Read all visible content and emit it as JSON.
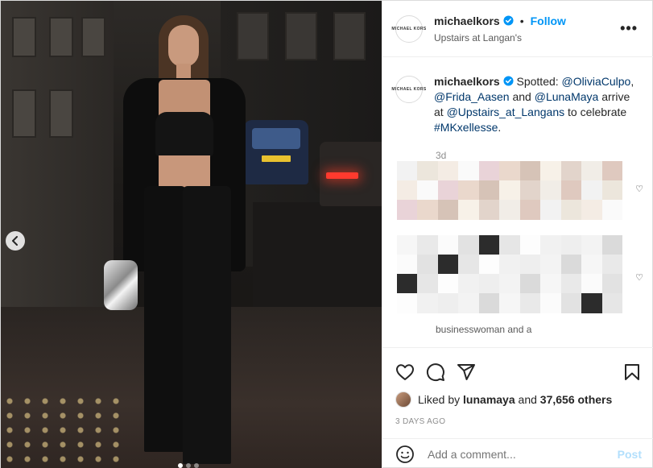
{
  "header": {
    "avatar_text": "MICHAEL KORS",
    "username": "michaelkors",
    "separator": "•",
    "follow_label": "Follow",
    "location": "Upstairs at Langan's",
    "more_label": "•••"
  },
  "caption": {
    "username": "michaelkors",
    "text_1": "Spotted: ",
    "mention_1": "@OliviaCulpo",
    "text_2": ", ",
    "mention_2": "@Frida_Aasen",
    "text_3": " and ",
    "mention_3": "@LunaMaya",
    "text_4": " arrive at ",
    "mention_4": "@Upstairs_at_Langans",
    "text_5": " to celebrate ",
    "hashtag": "#MKxellesse",
    "text_6": ".",
    "age": "3d"
  },
  "comments": {
    "partial_text": "businesswoman and a"
  },
  "likes": {
    "prefix": "Liked by ",
    "user": "lunamaya",
    "middle": " and ",
    "count": "37,656 others"
  },
  "timestamp": "3 DAYS AGO",
  "add_comment": {
    "placeholder": "Add a comment...",
    "post_label": "Post"
  },
  "carousel": {
    "total": 3,
    "active_index": 0
  },
  "colors": {
    "accent": "#0095f6",
    "link": "#00376b",
    "muted": "#8e8e8e",
    "post_disabled": "#b2dffc"
  },
  "icons": {
    "prev": "chevron-left-icon",
    "like": "heart-icon",
    "comment": "comment-icon",
    "share": "paper-plane-icon",
    "save": "bookmark-icon",
    "emoji": "smiley-icon",
    "more": "more-options-icon",
    "verified": "verified-badge-icon"
  }
}
